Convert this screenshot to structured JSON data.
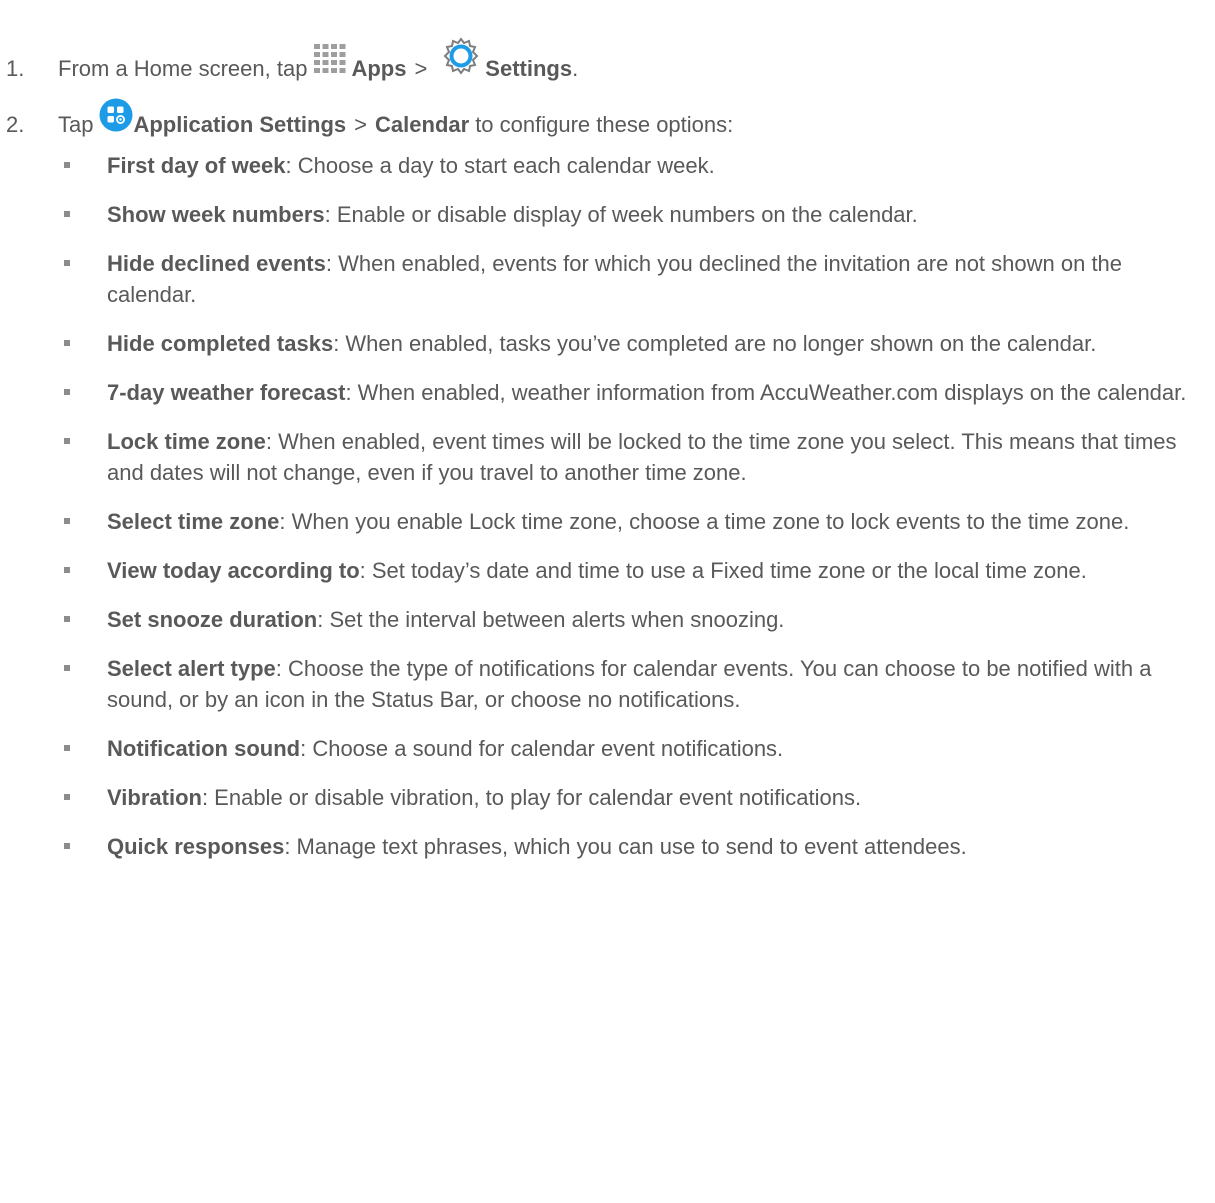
{
  "steps": [
    {
      "number": "1.",
      "text_1": "From a Home screen, tap",
      "apps_label": "Apps",
      "separator": ">",
      "settings_label": "Settings",
      "end": "."
    },
    {
      "number": "2.",
      "text_1": "Tap",
      "app_settings_label": "Application Settings",
      "separator": ">",
      "calendar_label": "Calendar",
      "text_2": "to configure these options:"
    }
  ],
  "options": [
    {
      "title": "First day of week",
      "desc": ": Choose a day to start each calendar week."
    },
    {
      "title": "Show week numbers",
      "desc": ": Enable or disable display of week numbers on the calendar."
    },
    {
      "title": "Hide declined events",
      "desc": ": When enabled, events for which you declined the invitation are not shown on the calendar."
    },
    {
      "title": "Hide completed tasks",
      "desc": ": When enabled, tasks you’ve completed are no longer shown on the calendar."
    },
    {
      "title": "7-day weather forecast",
      "desc": ": When enabled, weather information from AccuWeather.com displays on the calendar."
    },
    {
      "title": "Lock time zone",
      "desc": ": When enabled, event times will be locked to the time zone you select. This means that times and dates will not change, even if you travel to another time zone."
    },
    {
      "title": "Select time zone",
      "desc": ": When you enable Lock time zone, choose a time zone to lock events to the time zone."
    },
    {
      "title": "View today according to",
      "desc": ": Set today’s date and time to use a Fixed time zone or the local time zone."
    },
    {
      "title": "Set snooze duration",
      "desc": ": Set the interval between alerts when snoozing."
    },
    {
      "title": "Select alert type",
      "desc": ": Choose the type of notifications for calendar events. You can choose to be notified with a sound, or by an icon in the Status Bar, or choose no notifications."
    },
    {
      "title": "Notification sound",
      "desc": ": Choose a sound for calendar event notifications."
    },
    {
      "title": "Vibration",
      "desc": ": Enable or disable vibration, to play for calendar event notifications."
    },
    {
      "title": "Quick responses",
      "desc": ": Manage text phrases, which you can use to send to event attendees."
    }
  ],
  "icons": {
    "apps": "apps-grid-icon",
    "settings": "settings-gear-icon",
    "application_settings": "application-settings-icon"
  },
  "colors": {
    "text": "#595959",
    "accent_blue": "#1e9be6",
    "grid_gray": "#9e9e9e"
  }
}
